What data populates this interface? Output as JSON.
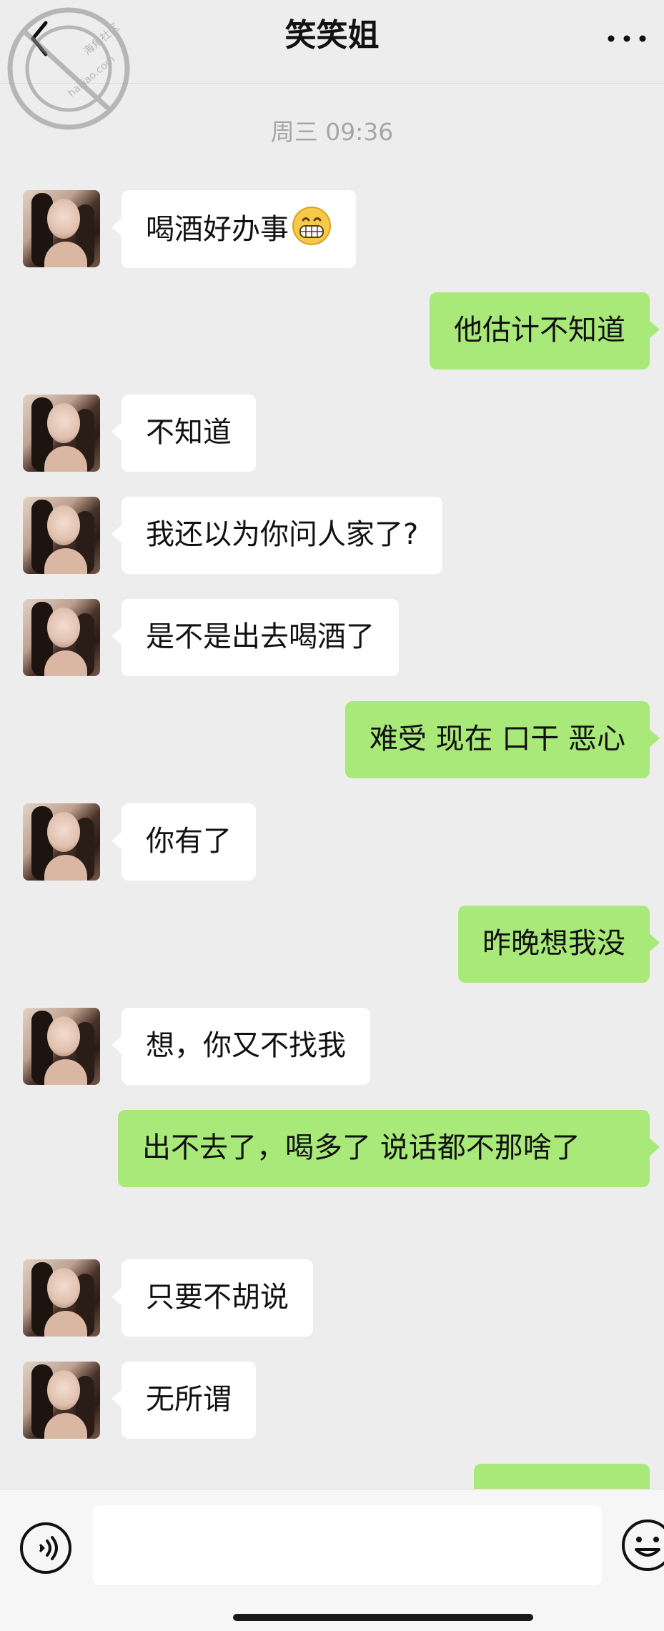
{
  "header": {
    "title": "笑笑姐"
  },
  "watermark": {
    "line1": "海角社区",
    "line2": "haijiao.com"
  },
  "timestamp": "周三 09:36",
  "messages": [
    {
      "side": "left",
      "text": "喝酒好办事"
    },
    {
      "side": "right",
      "text": "他估计不知道"
    },
    {
      "side": "left",
      "text": "不知道"
    },
    {
      "side": "left",
      "text": "我还以为你问人家了?"
    },
    {
      "side": "left",
      "text": "是不是出去喝酒了"
    },
    {
      "side": "right",
      "text": "难受 现在 口干 恶心"
    },
    {
      "side": "left",
      "text": "你有了"
    },
    {
      "side": "right",
      "text": "昨晚想我没"
    },
    {
      "side": "left",
      "text": "想，你又不找我"
    },
    {
      "side": "right",
      "text": "出不去了，喝多了 说话都不那啥了"
    },
    {
      "side": "left",
      "text": "只要不胡说"
    },
    {
      "side": "left",
      "text": "无所谓"
    }
  ],
  "icons": {
    "back": "back-arrow-icon",
    "more": "more-options-icon",
    "voice": "voice-icon",
    "emoji": "emoji-icon",
    "grinning": "grinning-emoji"
  },
  "colors": {
    "background": "#ededed",
    "sent_bubble": "#a9e97a",
    "received_bubble": "#ffffff",
    "timestamp": "#a6a6a6"
  }
}
